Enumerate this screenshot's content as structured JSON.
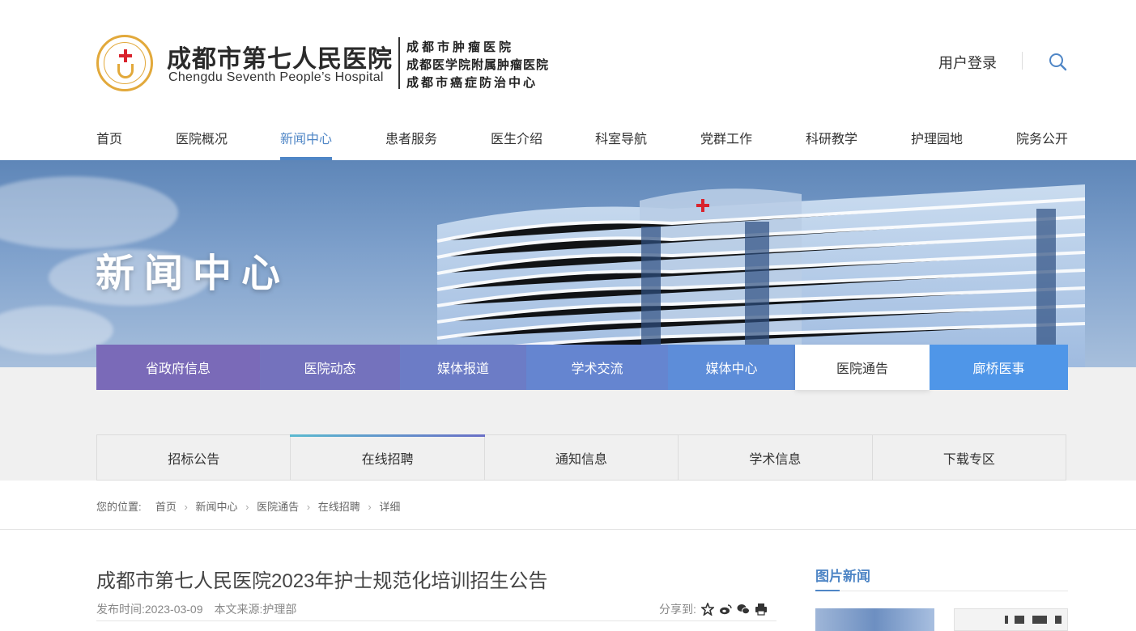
{
  "header": {
    "logo_cn": "成都市第七人民医院",
    "logo_en": "Chengdu Seventh People’s Hospital",
    "logo_sub1": "成都市肿瘤医院",
    "logo_sub2": "成都医学院附属肿瘤医院",
    "logo_sub3": "成都市癌症防治中心",
    "login": "用户登录"
  },
  "nav": {
    "items": [
      "首页",
      "医院概况",
      "新闻中心",
      "患者服务",
      "医生介绍",
      "科室导航",
      "党群工作",
      "科研教学",
      "护理园地",
      "院务公开"
    ],
    "active": "新闻中心"
  },
  "banner": {
    "title": "新闻中心"
  },
  "categories": {
    "items": [
      "省政府信息",
      "医院动态",
      "媒体报道",
      "学术交流",
      "媒体中心",
      "医院通告",
      "廊桥医事"
    ],
    "active": "医院通告"
  },
  "subtabs": {
    "items": [
      "招标公告",
      "在线招聘",
      "通知信息",
      "学术信息",
      "下载专区"
    ],
    "active": "在线招聘"
  },
  "breadcrumb": {
    "label": "您的位置:",
    "items": [
      "首页",
      "新闻中心",
      "医院通告",
      "在线招聘",
      "详细"
    ]
  },
  "article": {
    "title": "成都市第七人民医院2023年护士规范化培训招生公告",
    "date_label": "发布时间:",
    "date": "2023-03-09",
    "source_label": "本文来源:",
    "source": "护理部",
    "share_label": "分享到:"
  },
  "sidebar": {
    "pic_news_title": "图片新闻"
  },
  "colors": {
    "accent": "#4f86c6",
    "cat_gradient_start": "#7a6ab8",
    "cat_gradient_end": "#4f96e8"
  }
}
